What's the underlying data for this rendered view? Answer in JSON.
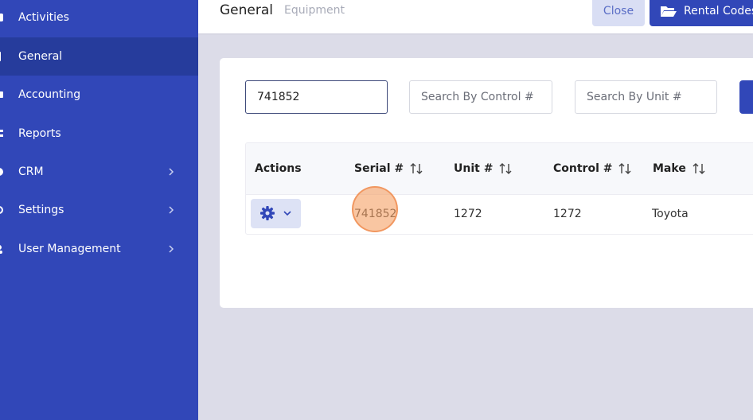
{
  "sidebar": {
    "items": [
      {
        "label": "Activities",
        "icon": "activity-icon",
        "has_chevron": false
      },
      {
        "label": "General",
        "icon": "general-icon",
        "has_chevron": false,
        "active": true
      },
      {
        "label": "Accounting",
        "icon": "accounting-icon",
        "has_chevron": false
      },
      {
        "label": "Reports",
        "icon": "reports-icon",
        "has_chevron": false
      },
      {
        "label": "CRM",
        "icon": "crm-icon",
        "has_chevron": true
      },
      {
        "label": "Settings",
        "icon": "settings-icon",
        "has_chevron": true
      },
      {
        "label": "User Management",
        "icon": "user-management-icon",
        "has_chevron": true
      }
    ]
  },
  "header": {
    "title": "General",
    "subtitle": "Equipment",
    "close_label": "Close",
    "rental_label": "Rental Codes"
  },
  "search": {
    "serial_value": "741852",
    "control_placeholder": "Search By Control #",
    "unit_placeholder": "Search By Unit #"
  },
  "table": {
    "columns": [
      "Actions",
      "Serial #",
      "Unit #",
      "Control #",
      "Make"
    ],
    "rows": [
      {
        "serial": "741852",
        "unit": "1272",
        "control": "1272",
        "make": "Toyota"
      }
    ]
  },
  "colors": {
    "sidebar": "#3147b8",
    "sidebar_active": "#263c9c",
    "accent": "#3147b8",
    "background": "#dcdce8"
  }
}
